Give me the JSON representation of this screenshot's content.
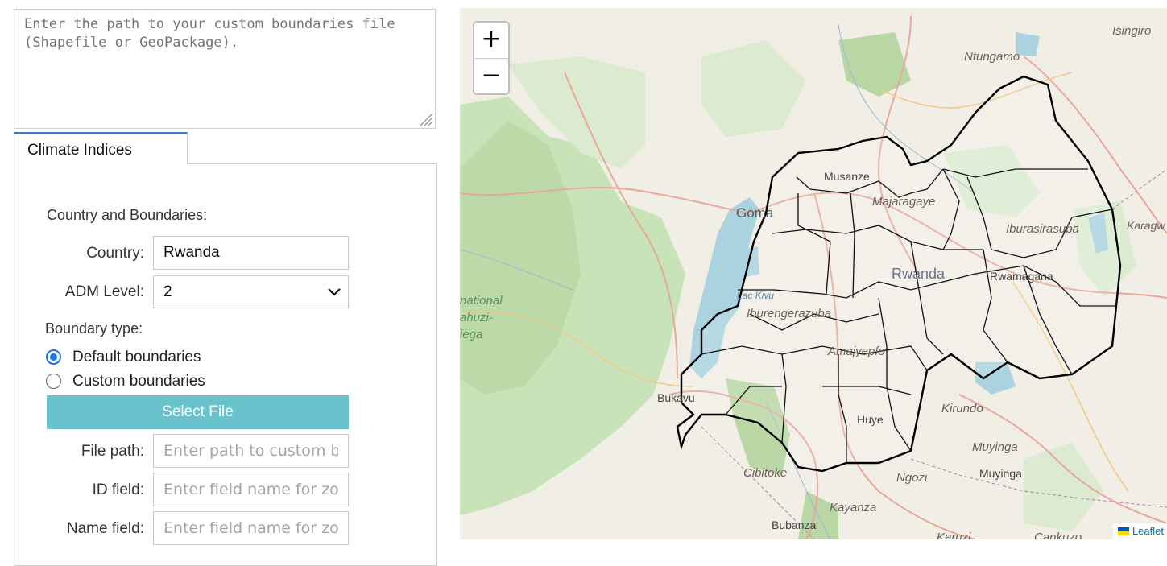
{
  "boundaries_file": {
    "placeholder": "Enter the path to your custom boundaries file (Shapefile or GeoPackage)."
  },
  "tabs": [
    {
      "label": "Climate Indices",
      "active": true
    }
  ],
  "form": {
    "section_title": "Country and Boundaries:",
    "country_label": "Country:",
    "country_value": "Rwanda",
    "adm_label": "ADM Level:",
    "adm_value": "2",
    "boundary_type_label": "Boundary type:",
    "boundary_options": [
      {
        "label": "Default boundaries",
        "selected": true
      },
      {
        "label": "Custom boundaries",
        "selected": false
      }
    ],
    "select_file_label": "Select File",
    "file_path_label": "File path:",
    "file_path_placeholder": "Enter path to custom boundaries file",
    "id_field_label": "ID field:",
    "id_field_placeholder": "Enter field name for zonal IDs",
    "name_field_label": "Name field:",
    "name_field_placeholder": "Enter field name for zonal names"
  },
  "map": {
    "zoom_in": "+",
    "zoom_out": "−",
    "attribution": "Leaflet",
    "labels": {
      "isingiro": "Isingiro",
      "ntungamo": "Ntungamo",
      "musanze": "Musanze",
      "majaragaye": "Majaragaye",
      "goma": "Goma",
      "ibura": "Iburasirasuba",
      "karagwe": "Karagw",
      "rwanda": "Rwanda",
      "rwamagana": "Rwamagana",
      "national": "national",
      "kahuzi": "ahuzi-",
      "biega": "iega",
      "lac_kivu": "Lac Kivu",
      "iburengerazuba": "Iburengerazuba",
      "amajyepfo": "Amajyepfo",
      "bukavu": "Bukavu",
      "kirundo": "Kirundo",
      "huye": "Huye",
      "muyinga_region": "Muyinga",
      "muyinga_city": "Muyinga",
      "cibitoke": "Cibitoke",
      "ngozi": "Ngozi",
      "kayanza": "Kayanza",
      "bubanza": "Bubanza",
      "karuzi": "Karuzi",
      "cankuzo": "Cankuzo"
    },
    "colors": {
      "water": "#aad3df",
      "forest": "#c8e3b8",
      "park": "#b9d7a4",
      "land": "#f1eee6",
      "roads": "#e8a79a"
    }
  }
}
